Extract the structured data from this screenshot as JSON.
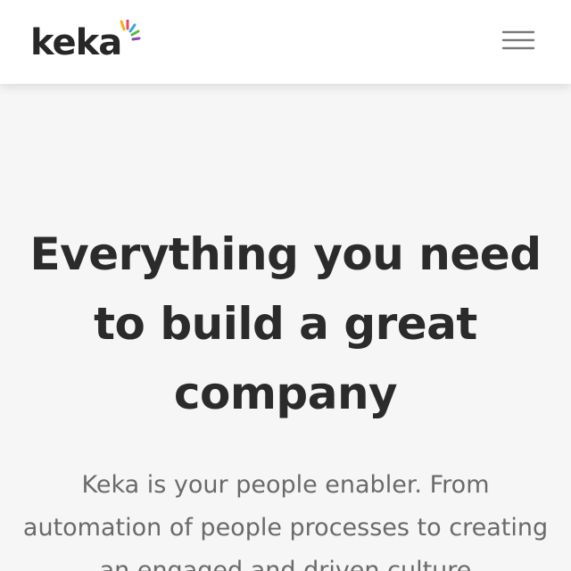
{
  "header": {
    "logo_text": "keka",
    "logo_ray_colors": [
      "#f2b01e",
      "#e94b67",
      "#3aa7dc",
      "#58b947",
      "#8d4aa8"
    ],
    "menu_icon": "hamburger-menu-icon"
  },
  "hero": {
    "title": "Everything you need to build a great company",
    "subtitle": "Keka is your people enabler. From automation of people processes to creating an engaged and driven culture"
  },
  "colors": {
    "header_bg": "#ffffff",
    "page_bg": "#f6f6f6",
    "title_text": "#2b2b2b",
    "subtitle_text": "#6a6a6a"
  }
}
